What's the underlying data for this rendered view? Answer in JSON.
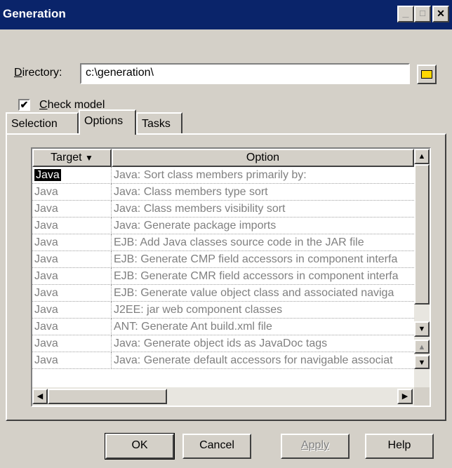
{
  "window": {
    "title": "Generation",
    "minimize_glyph": "_",
    "maximize_glyph": "□",
    "close_glyph": "✕"
  },
  "directory": {
    "label": "Directory:",
    "value": "c:\\generation\\",
    "browse_icon": "folder-icon"
  },
  "check_model": {
    "label": "Check model",
    "checked": true,
    "check_glyph": "✔"
  },
  "tabs": [
    {
      "label": "Selection",
      "active": false
    },
    {
      "label": "Options",
      "active": true
    },
    {
      "label": "Tasks",
      "active": false
    }
  ],
  "grid": {
    "columns": [
      {
        "label": "Target",
        "sort_glyph": "▼"
      },
      {
        "label": "Option"
      }
    ],
    "rows": [
      {
        "target": "Java",
        "option": "Java: Sort class members primarily by:",
        "selected": true
      },
      {
        "target": "Java",
        "option": "Java: Class members type sort"
      },
      {
        "target": "Java",
        "option": "Java: Class members visibility sort"
      },
      {
        "target": "Java",
        "option": "Java: Generate package imports"
      },
      {
        "target": "Java",
        "option": "EJB: Add Java classes source code in the JAR file"
      },
      {
        "target": "Java",
        "option": "EJB: Generate CMP field accessors in component interfa"
      },
      {
        "target": "Java",
        "option": "EJB: Generate CMR field accessors in component interfa"
      },
      {
        "target": "Java",
        "option": "EJB: Generate value object class and associated naviga"
      },
      {
        "target": "Java",
        "option": "J2EE: jar web component classes"
      },
      {
        "target": "Java",
        "option": "ANT: Generate Ant build.xml file"
      },
      {
        "target": "Java",
        "option": "Java: Generate object ids as JavaDoc tags"
      },
      {
        "target": "Java",
        "option": "Java: Generate default accessors for navigable associat"
      }
    ],
    "scroll_up_glyph": "▲",
    "scroll_down_glyph": "▼",
    "scroll_left_glyph": "◀",
    "scroll_right_glyph": "▶"
  },
  "buttons": {
    "ok": "OK",
    "cancel": "Cancel",
    "apply": "Apply",
    "help": "Help"
  }
}
